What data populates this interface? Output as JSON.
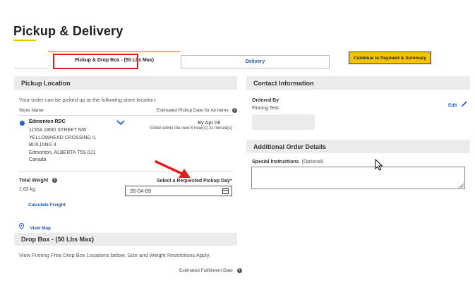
{
  "page": {
    "title": "Pickup & Delivery"
  },
  "tabs": [
    {
      "label": "Pickup & Drop Box - (50 Lbs Max)"
    },
    {
      "label": "Delivery"
    }
  ],
  "continue_label": "Continue to Payment & Summary",
  "pickup": {
    "heading": "Pickup Location",
    "intro": "Your order can be picked up at the following store location:",
    "store_col": "Store Name",
    "date_col": "Estimated Pickup Date for All Items",
    "store": {
      "name": "Edmonton RDC",
      "address1": "11554 186th STREET NW",
      "address2": "YELLOWHEAD CROSSING II,",
      "address3": "BUILDING 4",
      "city": "Edmonton, ALBERTA T5S 0J1",
      "country": "Canada"
    },
    "by_date": "By Apr 06",
    "order_within": "Order within the next 6 hour(s) 21 minute(s)",
    "total_weight_label": "Total Weight",
    "total_weight": "1.63 kg",
    "calc_freight": "Calculate Freight",
    "requested_label": "Select a Requested Pickup Day*",
    "requested_value": "26-04-09",
    "view_map": "View Map"
  },
  "dropbox": {
    "heading": "Drop Box - (50 Lbs Max)",
    "intro": "View Finning Free Drop Box Locations below. Size and Weight Restrictions Apply.",
    "est_label": "Estimated Fulfillment Date"
  },
  "contact": {
    "heading": "Contact Information",
    "ordered_by_label": "Ordered By",
    "ordered_by": "Finning Test",
    "edit": "Edit"
  },
  "additional": {
    "heading": "Additional Order Details",
    "special_label": "Special Instructions",
    "optional": "(Optional)"
  },
  "colors": {
    "accent": "#f5c400",
    "link": "#1a56c4",
    "highlight": "#e02020"
  }
}
